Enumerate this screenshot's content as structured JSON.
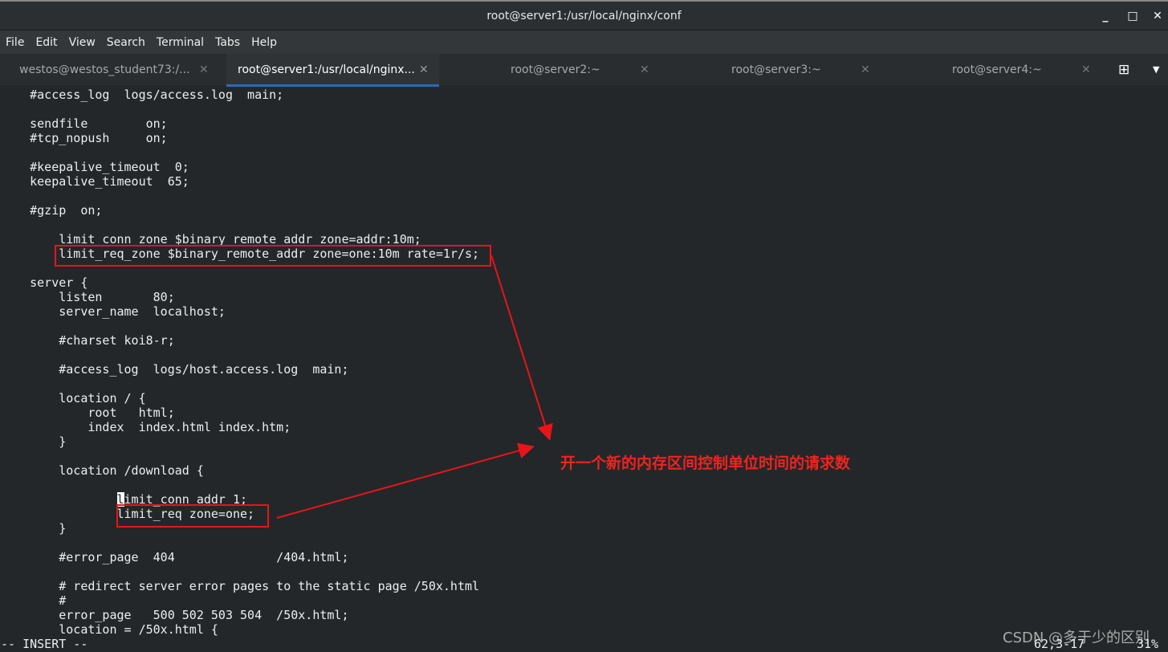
{
  "window": {
    "title": "root@server1:/usr/local/nginx/conf"
  },
  "menu": [
    "File",
    "Edit",
    "View",
    "Search",
    "Terminal",
    "Tabs",
    "Help"
  ],
  "tabs": [
    {
      "label": "westos@westos_student73:/...",
      "active": false
    },
    {
      "label": "root@server1:/usr/local/nginx...",
      "active": true
    },
    {
      "label": "root@server2:~",
      "active": false
    },
    {
      "label": "root@server3:~",
      "active": false
    },
    {
      "label": "root@server4:~",
      "active": false
    }
  ],
  "terminal": {
    "lines": [
      "    #access_log  logs/access.log  main;",
      "",
      "    sendfile        on;",
      "    #tcp_nopush     on;",
      "",
      "    #keepalive_timeout  0;",
      "    keepalive_timeout  65;",
      "",
      "    #gzip  on;",
      "",
      "        limit_conn_zone $binary_remote_addr zone=addr:10m;",
      "        limit_req_zone $binary_remote_addr zone=one:10m rate=1r/s;",
      "",
      "    server {",
      "        listen       80;",
      "        server_name  localhost;",
      "",
      "        #charset koi8-r;",
      "",
      "        #access_log  logs/host.access.log  main;",
      "",
      "        location / {",
      "            root   html;",
      "            index  index.html index.htm;",
      "        }",
      "",
      "        location /download {",
      "",
      "                limit_conn addr 1;",
      "                limit_req zone=one;",
      "        }",
      "",
      "        #error_page  404              /404.html;",
      "",
      "        # redirect server error pages to the static page /50x.html",
      "        #",
      "        error_page   500 502 503 504  /50x.html;",
      "        location = /50x.html {",
      "-- INSERT --"
    ],
    "mode": "-- INSERT --",
    "position": "62,3-17",
    "percent": "31%"
  },
  "annotation": "开一个新的内存区间控制单位时间的请求数",
  "watermark": "CSDN @多于少的区别",
  "colors": {
    "annotation": "#f0231e",
    "tab_active_underline": "#2a6ab2",
    "terminal_bg": "#23272a"
  }
}
